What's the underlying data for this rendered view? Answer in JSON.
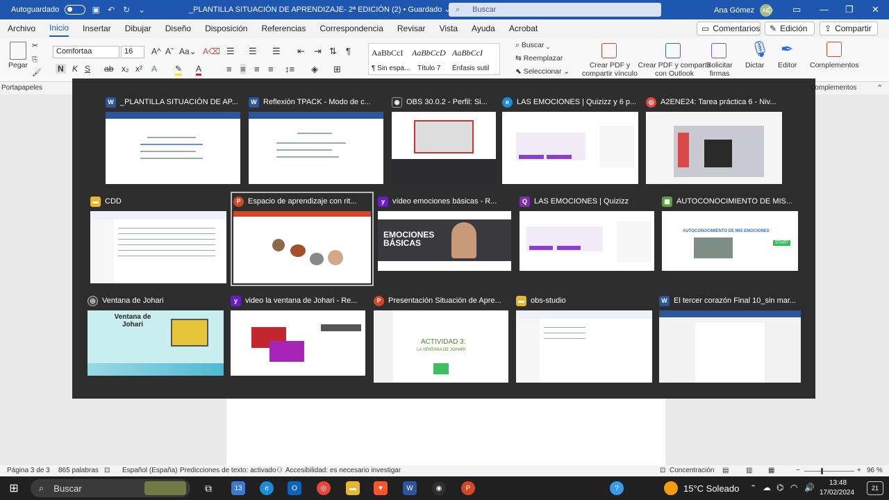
{
  "titlebar": {
    "autosave_label": "Autoguardado",
    "doc_title": "_PLANTILLA SITUACIÓN DE APRENDIZAJE- 2ª EDICIÓN (2) • Guardado ⌄",
    "search_placeholder": "Buscar",
    "user_name": "Ana Gómez",
    "user_initials": "AG"
  },
  "tabs": [
    "Archivo",
    "Inicio",
    "Insertar",
    "Dibujar",
    "Diseño",
    "Disposición",
    "Referencias",
    "Correspondencia",
    "Revisar",
    "Vista",
    "Ayuda",
    "Acrobat"
  ],
  "tab_buttons": {
    "comments": "Comentarios",
    "editing": "Edición",
    "share": "Compartir"
  },
  "ribbon": {
    "paste": "Pegar",
    "font_name": "Comfortaa",
    "font_size": "16",
    "styles": [
      {
        "sample": "AaBbCcI",
        "name": "¶ Sin espa..."
      },
      {
        "sample": "AaBbCcD",
        "name": "Título 7"
      },
      {
        "sample": "AaBbCcI",
        "name": "Énfasis sutil"
      }
    ],
    "find": "Buscar",
    "replace": "Reemplazar",
    "select": "Seleccionar",
    "create_pdf_share": "Crear PDF y compartir vínculo",
    "create_pdf_outlook": "Crear PDF y compartir con Outlook",
    "request_signatures": "Solicitar firmas",
    "dictate": "Dictar",
    "editor": "Editor",
    "addins": "Complementos",
    "clipboard_group": "Portapapeles"
  },
  "switcher": {
    "windows": [
      {
        "title": "_PLANTILLA SITUACIÓN DE AP...",
        "app": "W",
        "color": "#2b579a"
      },
      {
        "title": "Reflexión TPACK - Modo de c...",
        "app": "W",
        "color": "#2b579a"
      },
      {
        "title": "OBS 30.0.2 - Perfil: Si...",
        "app": "◉",
        "color": "#302e31"
      },
      {
        "title": "LAS EMOCIONES | Quizizz y 6 p...",
        "app": "e",
        "color": "#1f8ad8"
      },
      {
        "title": "A2ENE24: Tarea práctica 6 - Niv...",
        "app": "◎",
        "color": "#e8453c"
      },
      {
        "title": "CDD",
        "app": "▬",
        "color": "#e8b730"
      },
      {
        "title": "Espacio de aprendizaje con rit...",
        "app": "P",
        "color": "#d24726"
      },
      {
        "title": "vídeo emociones básicas - R...",
        "app": "y",
        "color": "#6a1cc7"
      },
      {
        "title": "LAS EMOCIONES | Quizizz",
        "app": "Q",
        "color": "#7b2fa8"
      },
      {
        "title": "AUTOCONOCIMIENTO DE MIS...",
        "app": "▦",
        "color": "#5aa13b"
      },
      {
        "title": "Ventana de Johari",
        "app": "◎",
        "color": "#444"
      },
      {
        "title": "video la ventana de Johari - Re...",
        "app": "y",
        "color": "#6a1cc7"
      },
      {
        "title": "Presentación Situación de Apre...",
        "app": "P",
        "color": "#d24726"
      },
      {
        "title": "obs-studio",
        "app": "▬",
        "color": "#e8b730"
      },
      {
        "title": "El tercer corazón Final 10_sin mar...",
        "app": "W",
        "color": "#2b579a"
      }
    ],
    "thumb_text": {
      "emociones": "EMOCIONES BÁSICAS",
      "johari_title": "Ventana de Johari",
      "actividad": "ACTIVIDAD 3:",
      "actividad_sub": "LA VENTANA DE JOHARI",
      "autocon": "AUTOCONOCIMIENTO DE MIS EMOCIONES",
      "start": "START"
    }
  },
  "statusbar": {
    "page": "Página 3 de 3",
    "words": "865 palabras",
    "language": "Español (España)",
    "predictions": "Predicciones de texto: activado",
    "accessibility": "Accesibilidad: es necesario investigar",
    "focus": "Concentración",
    "zoom": "96 %"
  },
  "taskbar": {
    "search": "Buscar",
    "weather": "15°C Soleado",
    "time": "13:48",
    "date": "17/02/2024",
    "notifications": "21"
  }
}
